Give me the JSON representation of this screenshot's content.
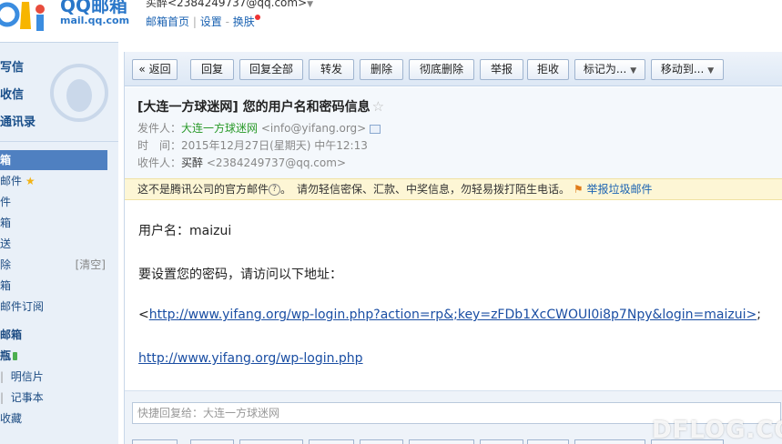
{
  "header": {
    "logo_title": "QQ邮箱",
    "logo_url": "mail.qq.com",
    "account": "买醉<2384249737@qq.com>",
    "links": [
      "邮箱首页",
      "设置",
      "换肤"
    ],
    "separator": "|",
    "dash": "-"
  },
  "sidebar": {
    "top_items": [
      "写信",
      "收信",
      "通讯录"
    ],
    "items": [
      {
        "label": "箱",
        "active": true
      },
      {
        "label": "邮件"
      },
      {
        "label": "件"
      },
      {
        "label": "箱"
      },
      {
        "label": "送"
      },
      {
        "label": "除",
        "extra": "[清空]"
      },
      {
        "label": "箱"
      },
      {
        "label": "邮件订阅"
      },
      {
        "label": "邮箱"
      },
      {
        "label": "瓶"
      },
      {
        "label": "明信片",
        "prefix": "|"
      },
      {
        "label": "记事本",
        "prefix": "|"
      },
      {
        "label": "收藏"
      }
    ]
  },
  "toolbar": {
    "back": "« 返回",
    "reply": "回复",
    "reply_all": "回复全部",
    "forward": "转发",
    "delete": "删除",
    "delete_forever": "彻底删除",
    "report": "举报",
    "reject": "拒收",
    "mark_as": "标记为...",
    "move_to": "移动到..."
  },
  "mail": {
    "subject": "[大连一方球迷网] 您的用户名和密码信息",
    "from_label": "发件人：",
    "from_name": "大连一方球迷网",
    "from_addr": "<info@yifang.org>",
    "time_label": "时　间：",
    "time_value": "2015年12月27日(星期天) 中午12:13",
    "to_label": "收件人：",
    "to_name": "买醉",
    "to_addr": "<2384249737@qq.com>"
  },
  "notice": {
    "text1": "这不是腾讯公司的官方邮件",
    "text2": "。　请勿轻信密保、汇款、中奖信息，勿轻易拨打陌生电话。",
    "report": "举报垃圾邮件"
  },
  "body": {
    "line1": "用户名：maizui",
    "line2": "要设置您的密码，请访问以下地址：",
    "reset_link_prefix": "<",
    "reset_link": "http://www.yifang.org/wp-login.php?action=rp&;key=zFDb1XcCWOUI0i8p7Npy&login=maizui>",
    "reset_link_suffix": ";",
    "login_link": "http://www.yifang.org/wp-login.php"
  },
  "reply": {
    "placeholder": "快捷回复给：大连一方球迷网"
  },
  "watermark": "DFLOG.COM"
}
